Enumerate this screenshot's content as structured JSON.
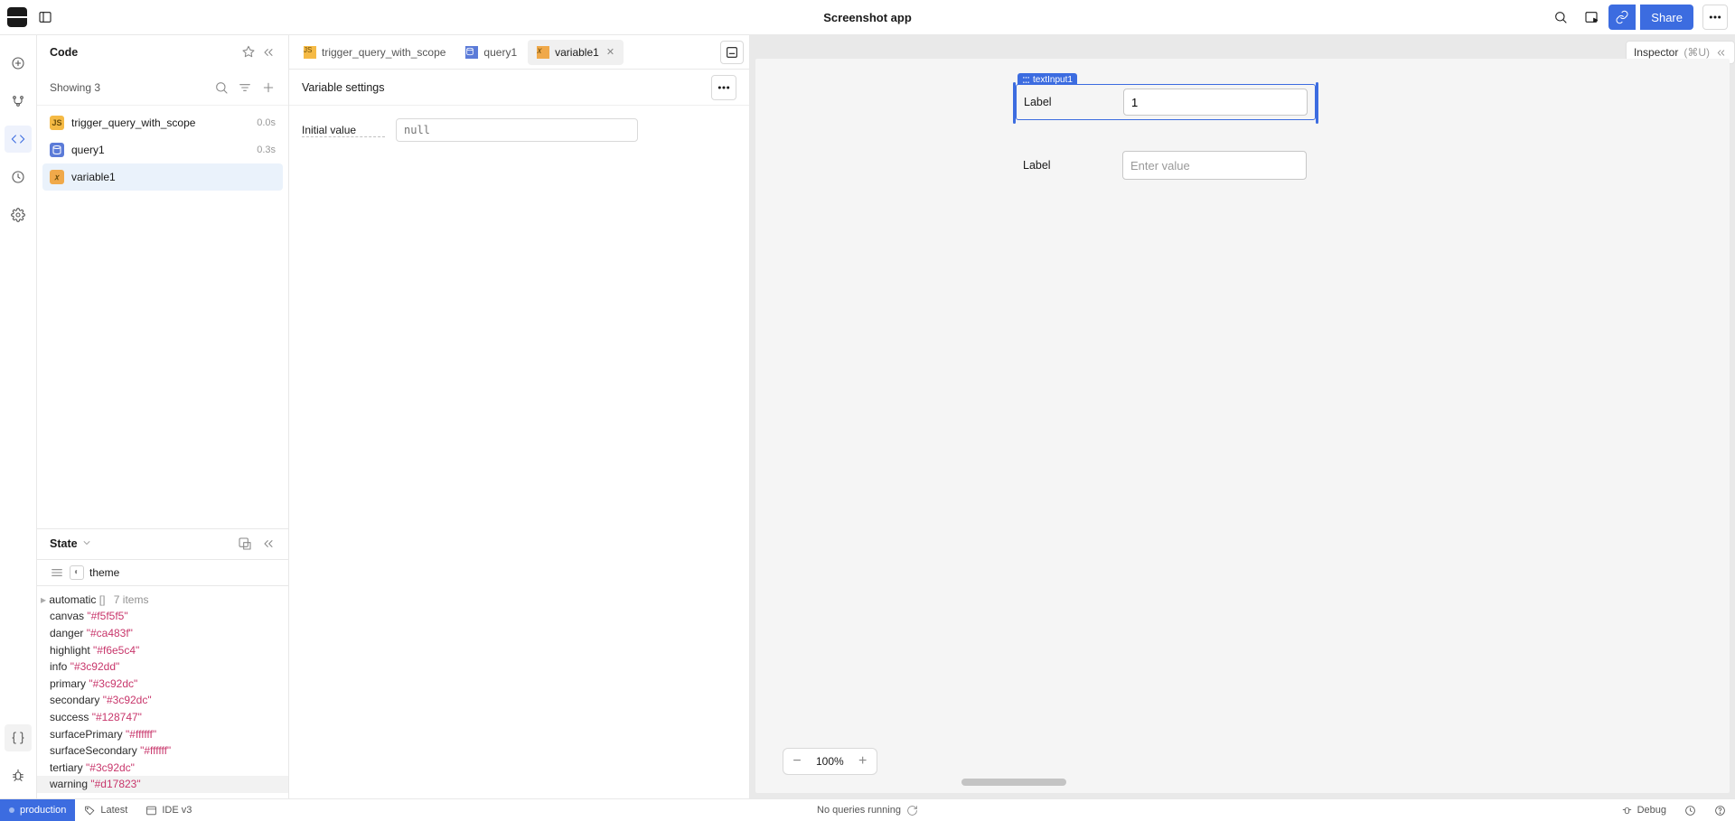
{
  "app_title": "Screenshot app",
  "topbar": {
    "share_label": "Share"
  },
  "inspector_tab": {
    "label": "Inspector",
    "shortcut": "(⌘U)"
  },
  "code_panel": {
    "header": "Code",
    "showing": "Showing 3",
    "items": [
      {
        "name": "trigger_query_with_scope",
        "dur": "0.0s",
        "tag": "JS"
      },
      {
        "name": "query1",
        "dur": "0.3s",
        "tag": "SQL"
      },
      {
        "name": "variable1",
        "dur": "",
        "tag": "X"
      }
    ]
  },
  "state_panel": {
    "header": "State",
    "breadcrumb": "theme",
    "automatic": {
      "label": "automatic",
      "bracket": "[]",
      "count": "7 items"
    },
    "rows": [
      {
        "k": "canvas",
        "v": "\"#f5f5f5\""
      },
      {
        "k": "danger",
        "v": "\"#ca483f\""
      },
      {
        "k": "highlight",
        "v": "\"#f6e5c4\""
      },
      {
        "k": "info",
        "v": "\"#3c92dd\""
      },
      {
        "k": "primary",
        "v": "\"#3c92dc\""
      },
      {
        "k": "secondary",
        "v": "\"#3c92dc\""
      },
      {
        "k": "success",
        "v": "\"#128747\""
      },
      {
        "k": "surfacePrimary",
        "v": "\"#ffffff\""
      },
      {
        "k": "surfaceSecondary",
        "v": "\"#ffffff\""
      },
      {
        "k": "tertiary",
        "v": "\"#3c92dc\""
      },
      {
        "k": "warning",
        "v": "\"#d17823\""
      }
    ]
  },
  "tabs": [
    {
      "label": "trigger_query_with_scope",
      "tag": "JS"
    },
    {
      "label": "query1",
      "tag": "SQL"
    },
    {
      "label": "variable1",
      "tag": "X"
    }
  ],
  "settings": {
    "title": "Variable settings",
    "initial_value_label": "Initial value",
    "initial_value_placeholder": "null"
  },
  "canvas": {
    "comp_tag": "textInput1",
    "field1": {
      "label": "Label",
      "value": "1"
    },
    "field2": {
      "label": "Label",
      "placeholder": "Enter value"
    }
  },
  "zoom": "100%",
  "statusbar": {
    "env": "production",
    "latest": "Latest",
    "ide": "IDE v3",
    "center": "No queries running",
    "debug": "Debug"
  }
}
